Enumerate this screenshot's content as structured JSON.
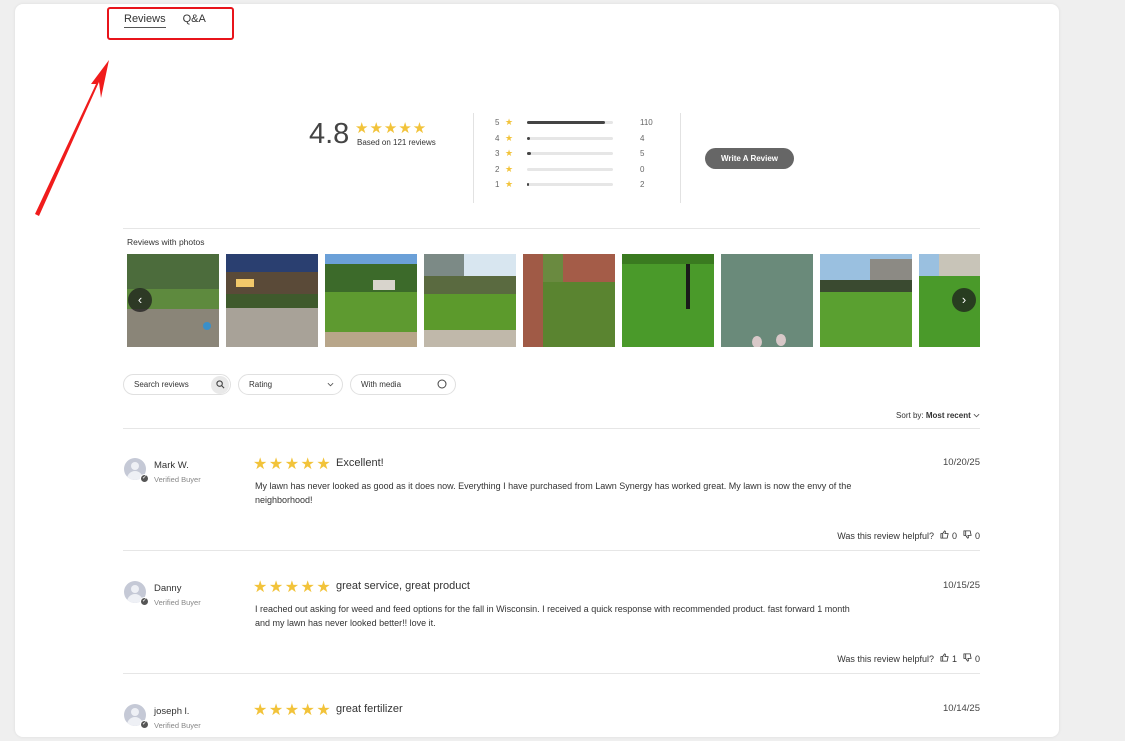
{
  "tabs": [
    {
      "label": "Reviews",
      "active": true
    },
    {
      "label": "Q&A",
      "active": false
    }
  ],
  "summary": {
    "average": "4.8",
    "stars": "★★★★★",
    "based_on": "Based on 121 reviews",
    "histogram": [
      {
        "stars": "5",
        "count": "110",
        "fraction": 0.91
      },
      {
        "stars": "4",
        "count": "4",
        "fraction": 0.033
      },
      {
        "stars": "3",
        "count": "5",
        "fraction": 0.041
      },
      {
        "stars": "2",
        "count": "0",
        "fraction": 0
      },
      {
        "stars": "1",
        "count": "2",
        "fraction": 0.017
      }
    ],
    "write_button": "Write A Review"
  },
  "photos": {
    "label": "Reviews with photos",
    "count": 9
  },
  "filters": {
    "search_placeholder": "Search reviews",
    "rating_label": "Rating",
    "media_label": "With media"
  },
  "sort": {
    "prefix": "Sort by:",
    "value": "Most recent"
  },
  "helpful_text": "Was this review helpful?",
  "reviews": [
    {
      "name": "Mark W.",
      "verified": "Verified Buyer",
      "stars": "★★★★★",
      "title": "Excellent!",
      "date": "10/20/25",
      "body": "My lawn has never looked as good as it does now. Everything I have purchased from Lawn Synergy has worked great. My lawn is now the envy of the neighborhood!",
      "up": "0",
      "down": "0"
    },
    {
      "name": "Danny",
      "verified": "Verified Buyer",
      "stars": "★★★★★",
      "title": "great service, great product",
      "date": "10/15/25",
      "body": "I reached out asking for weed and feed options for the fall in Wisconsin. I received a quick response with recommended product. fast forward 1 month and my lawn has never looked better!! love it.",
      "up": "1",
      "down": "0"
    },
    {
      "name": "joseph l.",
      "verified": "Verified Buyer",
      "stars": "★★★★★",
      "title": "great fertilizer",
      "date": "10/14/25",
      "body": "",
      "up": "",
      "down": ""
    }
  ]
}
